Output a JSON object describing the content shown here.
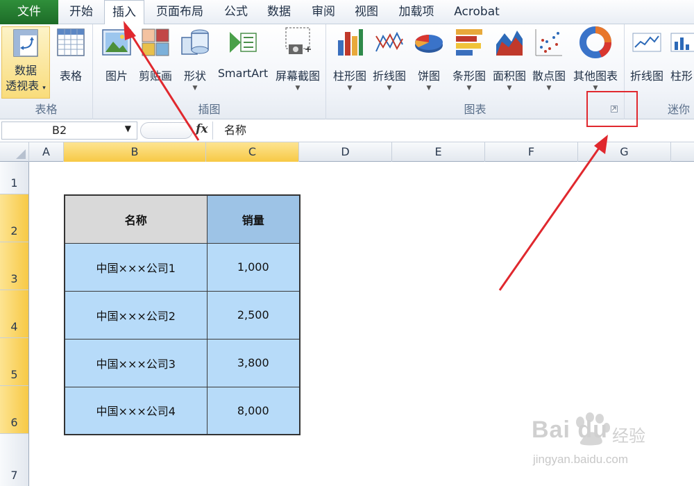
{
  "menu": {
    "tabs": [
      {
        "label": "文件"
      },
      {
        "label": "开始"
      },
      {
        "label": "插入"
      },
      {
        "label": "页面布局"
      },
      {
        "label": "公式"
      },
      {
        "label": "数据"
      },
      {
        "label": "审阅"
      },
      {
        "label": "视图"
      },
      {
        "label": "加载项"
      },
      {
        "label": "Acrobat"
      }
    ],
    "active_tab": "插入"
  },
  "ribbon": {
    "groups": {
      "tables": {
        "label": "表格",
        "buttons": [
          {
            "label_line1": "数据",
            "label_line2": "透视表"
          },
          {
            "label": "表格"
          }
        ]
      },
      "illustrations": {
        "label": "插图",
        "buttons": [
          {
            "label": "图片"
          },
          {
            "label": "剪贴画"
          },
          {
            "label": "形状"
          },
          {
            "label": "SmartArt"
          },
          {
            "label": "屏幕截图"
          }
        ]
      },
      "charts": {
        "label": "图表",
        "buttons": [
          {
            "label": "柱形图"
          },
          {
            "label": "折线图"
          },
          {
            "label": "饼图"
          },
          {
            "label": "条形图"
          },
          {
            "label": "面积图"
          },
          {
            "label": "散点图"
          },
          {
            "label": "其他图表"
          }
        ]
      },
      "sparklines": {
        "label": "迷你",
        "buttons": [
          {
            "label": "折线图"
          },
          {
            "label": "柱形"
          }
        ]
      }
    }
  },
  "formula_bar": {
    "name_box": "B2",
    "fx": "fx",
    "content": "名称"
  },
  "grid": {
    "columns": [
      "A",
      "B",
      "C",
      "D",
      "E",
      "F",
      "G"
    ],
    "rows": [
      "1",
      "2",
      "3",
      "4",
      "5",
      "6",
      "7"
    ],
    "selected_columns": [
      "B",
      "C"
    ],
    "selected_rows": [
      "2",
      "3",
      "4",
      "5",
      "6"
    ]
  },
  "table": {
    "headers": [
      "名称",
      "销量"
    ],
    "rows": [
      [
        "中国×××公司1",
        "1,000"
      ],
      [
        "中国×××公司2",
        "2,500"
      ],
      [
        "中国×××公司3",
        "3,800"
      ],
      [
        "中国×××公司4",
        "8,000"
      ]
    ]
  },
  "watermark": {
    "brand": "Bai du",
    "cn": "经验",
    "url": "jingyan.baidu.com"
  },
  "colors": {
    "annotation_red": "#e0282e",
    "selection_yellow": "#f7c945",
    "cell_blue": "#b7dbf9",
    "header_blue": "#9dc3e6",
    "header_gray": "#d9d9d9"
  }
}
